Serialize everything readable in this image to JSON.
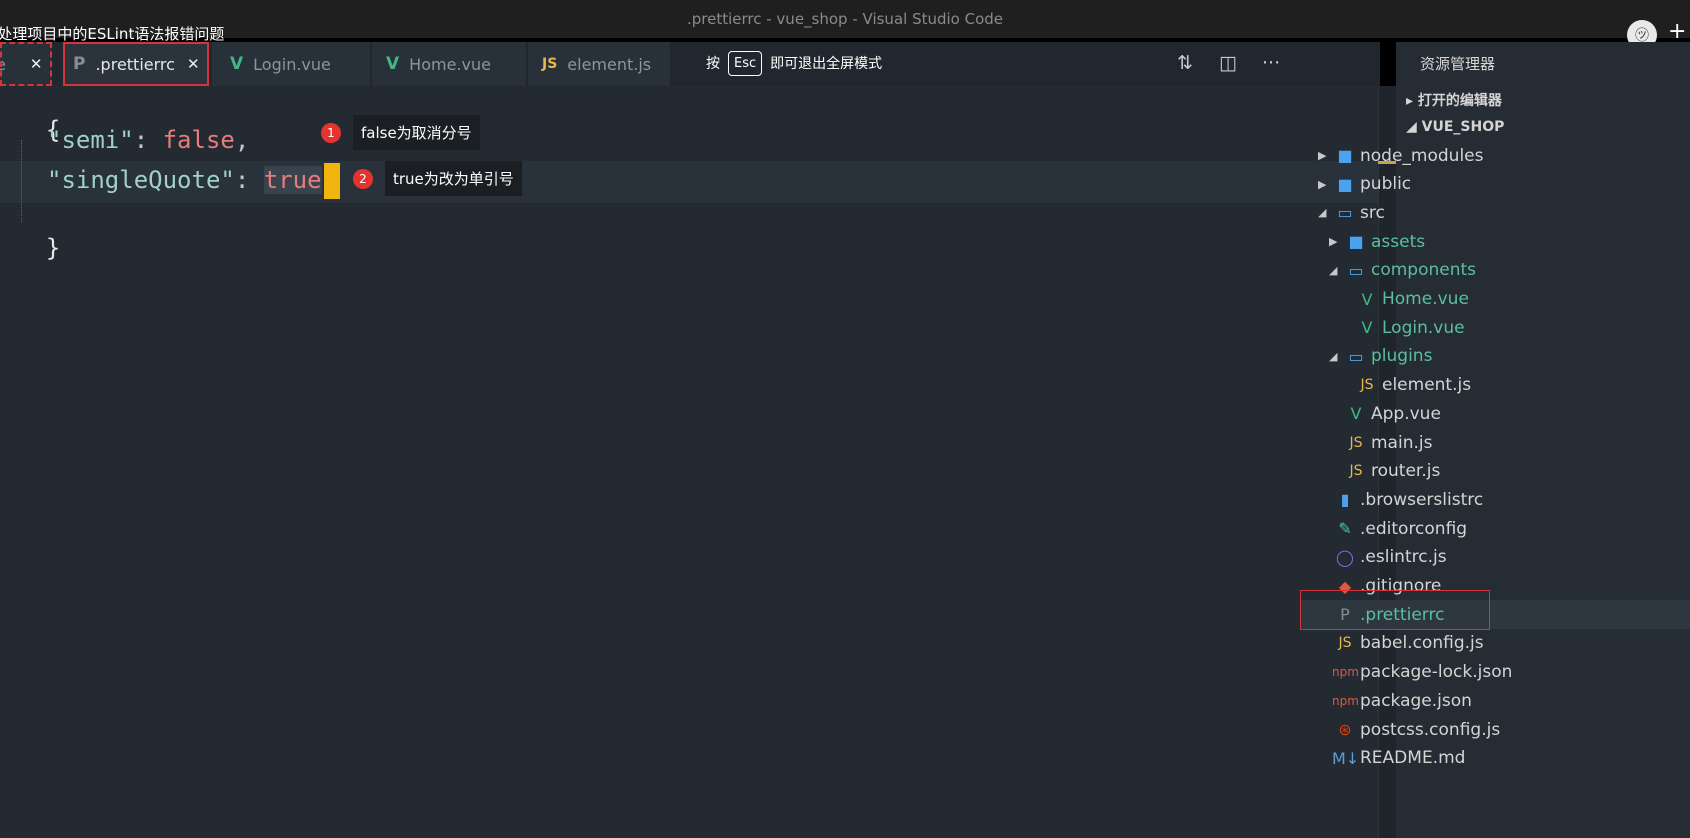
{
  "window": {
    "title": ".prettierrc - vue_shop - Visual Studio Code",
    "overlay_title": "-处理项目中的ESLint语法报错问题",
    "avatar_glyph": "㋡",
    "plus_glyph": "+"
  },
  "tabs": [
    {
      "label": "e",
      "icon": "",
      "close": "✕"
    },
    {
      "label": ".prettierrc",
      "icon": "P",
      "close": "✕"
    },
    {
      "label": "Login.vue",
      "icon": "V"
    },
    {
      "label": "Home.vue",
      "icon": "V"
    },
    {
      "label": "element.js",
      "icon": "JS"
    }
  ],
  "esc_hint": {
    "before": "按",
    "key": "Esc",
    "after": "即可退出全屏模式"
  },
  "toolbar_icons": [
    "git-compare-icon",
    "split-editor-icon",
    "more-icon"
  ],
  "editor": {
    "lines": {
      "open_brace": "{",
      "semi_key": "\"semi\"",
      "semi_value": "false",
      "quote_key": "\"singleQuote\"",
      "quote_value": "true",
      "close_brace": "}"
    },
    "notes": [
      {
        "num": "1",
        "text": "false为取消分号"
      },
      {
        "num": "2",
        "text": "true为改为单引号"
      }
    ]
  },
  "sidebar": {
    "header": "资源管理器",
    "open_editors": "打开的编辑器",
    "project": "VUE_SHOP",
    "tree": [
      {
        "label": "node_modules",
        "arrow": "▶",
        "icon": "■"
      },
      {
        "label": "public",
        "arrow": "▶",
        "icon": "■"
      },
      {
        "label": "src",
        "arrow": "◢",
        "icon": "▭"
      },
      {
        "label": "assets",
        "arrow": "▶",
        "icon": "■"
      },
      {
        "label": "components",
        "arrow": "◢",
        "icon": "▭"
      },
      {
        "label": "Home.vue",
        "icon": "V"
      },
      {
        "label": "Login.vue",
        "icon": "V"
      },
      {
        "label": "plugins",
        "arrow": "◢",
        "icon": "▭"
      },
      {
        "label": "element.js",
        "icon": "JS"
      },
      {
        "label": "App.vue",
        "icon": "V"
      },
      {
        "label": "main.js",
        "icon": "JS"
      },
      {
        "label": "router.js",
        "icon": "JS"
      },
      {
        "label": ".browserslistrc",
        "icon": "▮"
      },
      {
        "label": ".editorconfig",
        "icon": "✎"
      },
      {
        "label": ".eslintrc.js",
        "icon": "◯"
      },
      {
        "label": ".gitignore",
        "icon": "◆"
      },
      {
        "label": ".prettierrc",
        "icon": "P"
      },
      {
        "label": "babel.config.js",
        "icon": "JS"
      },
      {
        "label": "package-lock.json",
        "icon": "npm"
      },
      {
        "label": "package.json",
        "icon": "npm"
      },
      {
        "label": "postcss.config.js",
        "icon": "⊛"
      },
      {
        "label": "README.md",
        "icon": "M↓"
      }
    ]
  },
  "colors": {
    "editor_bg": "#232a31",
    "sidebar_bg": "#252c33",
    "cursor": "#f1b50d",
    "annotation_red": "#d6343b",
    "vue_green": "#41b883",
    "js_yellow": "#e8b84a"
  }
}
